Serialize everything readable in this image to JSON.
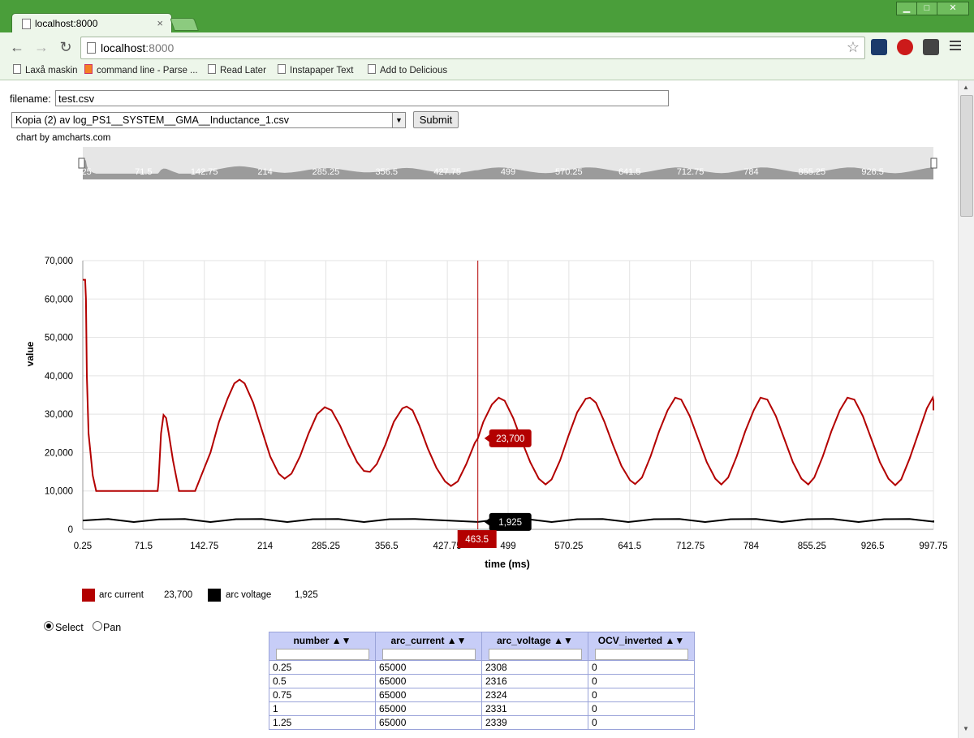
{
  "browser": {
    "tab_title": "localhost:8000",
    "url_host": "localhost",
    "url_port": ":8000",
    "bookmarks": [
      "Laxå maskin",
      "command line - Parse ...",
      "Read Later",
      "Instapaper Text",
      "Add to Delicious"
    ]
  },
  "form": {
    "filename_label": "filename:",
    "filename_value": "test.csv",
    "selected_file": "Kopia (2) av log_PS1__SYSTEM__GMA__Inductance_1.csv",
    "submit_label": "Submit"
  },
  "chart_credit": "chart by amcharts.com",
  "chart_data": {
    "type": "line",
    "xlabel": "time (ms)",
    "ylabel": "value",
    "ylim": [
      0,
      70000
    ],
    "yticks": [
      "0",
      "10,000",
      "20,000",
      "30,000",
      "40,000",
      "50,000",
      "60,000",
      "70,000"
    ],
    "xticks": [
      "0.25",
      "71.5",
      "142.75",
      "214",
      "285.25",
      "356.5",
      "427.75",
      "499",
      "570.25",
      "641.5",
      "712.75",
      "784",
      "855.25",
      "926.5",
      "997.75"
    ],
    "xlim": [
      0.25,
      997.75
    ],
    "grid": true,
    "cursor_x_label": "463.5",
    "series": [
      {
        "name": "arc current",
        "color": "#b30000",
        "cursor_value": "23,700",
        "points": [
          [
            0.25,
            65000
          ],
          [
            3,
            65000
          ],
          [
            4,
            60000
          ],
          [
            5,
            40000
          ],
          [
            7,
            25000
          ],
          [
            12,
            14000
          ],
          [
            16,
            10000
          ],
          [
            30,
            10000
          ],
          [
            60,
            10000
          ],
          [
            88,
            10000
          ],
          [
            89,
            12000
          ],
          [
            92,
            25000
          ],
          [
            95,
            29800
          ],
          [
            98,
            29000
          ],
          [
            101,
            25000
          ],
          [
            106,
            18000
          ],
          [
            113,
            10000
          ],
          [
            128,
            10000
          ],
          [
            132,
            10000
          ],
          [
            150,
            20000
          ],
          [
            160,
            28000
          ],
          [
            170,
            34000
          ],
          [
            178,
            38000
          ],
          [
            184,
            39000
          ],
          [
            190,
            38000
          ],
          [
            200,
            33000
          ],
          [
            210,
            26000
          ],
          [
            220,
            19000
          ],
          [
            230,
            14500
          ],
          [
            237,
            13200
          ],
          [
            245,
            14500
          ],
          [
            255,
            19000
          ],
          [
            265,
            25000
          ],
          [
            275,
            30000
          ],
          [
            284,
            31800
          ],
          [
            292,
            31000
          ],
          [
            302,
            27000
          ],
          [
            312,
            22000
          ],
          [
            322,
            17500
          ],
          [
            330,
            15200
          ],
          [
            337,
            15000
          ],
          [
            345,
            17000
          ],
          [
            355,
            22000
          ],
          [
            365,
            28000
          ],
          [
            375,
            31500
          ],
          [
            380,
            32000
          ],
          [
            387,
            31000
          ],
          [
            395,
            27000
          ],
          [
            405,
            21000
          ],
          [
            415,
            16000
          ],
          [
            425,
            12500
          ],
          [
            432,
            11300
          ],
          [
            440,
            12500
          ],
          [
            450,
            17000
          ],
          [
            460,
            22500
          ],
          [
            463.5,
            23700
          ],
          [
            470,
            28000
          ],
          [
            480,
            32500
          ],
          [
            488,
            34300
          ],
          [
            495,
            33500
          ],
          [
            505,
            29000
          ],
          [
            515,
            23000
          ],
          [
            525,
            17500
          ],
          [
            535,
            13200
          ],
          [
            543,
            11700
          ],
          [
            550,
            13000
          ],
          [
            560,
            18000
          ],
          [
            570,
            24500
          ],
          [
            580,
            30500
          ],
          [
            590,
            34000
          ],
          [
            595,
            34300
          ],
          [
            602,
            33000
          ],
          [
            612,
            28000
          ],
          [
            622,
            22000
          ],
          [
            632,
            16500
          ],
          [
            642,
            12800
          ],
          [
            648,
            11800
          ],
          [
            656,
            13500
          ],
          [
            666,
            19000
          ],
          [
            676,
            25500
          ],
          [
            686,
            31000
          ],
          [
            695,
            34300
          ],
          [
            702,
            33800
          ],
          [
            712,
            29500
          ],
          [
            722,
            23500
          ],
          [
            732,
            17500
          ],
          [
            742,
            13200
          ],
          [
            749,
            11700
          ],
          [
            757,
            13500
          ],
          [
            767,
            19000
          ],
          [
            777,
            25500
          ],
          [
            787,
            31000
          ],
          [
            795,
            34300
          ],
          [
            803,
            33800
          ],
          [
            813,
            29500
          ],
          [
            823,
            23500
          ],
          [
            833,
            17500
          ],
          [
            843,
            13200
          ],
          [
            851,
            11700
          ],
          [
            858,
            13500
          ],
          [
            868,
            19000
          ],
          [
            878,
            25500
          ],
          [
            888,
            31000
          ],
          [
            897,
            34300
          ],
          [
            905,
            33800
          ],
          [
            915,
            29500
          ],
          [
            925,
            23500
          ],
          [
            935,
            17500
          ],
          [
            945,
            13200
          ],
          [
            953,
            11500
          ],
          [
            960,
            13000
          ],
          [
            970,
            18500
          ],
          [
            980,
            25000
          ],
          [
            990,
            31500
          ],
          [
            997,
            34300
          ],
          [
            1007,
            33500
          ],
          [
            1015,
            31000
          ]
        ]
      },
      {
        "name": "arc voltage",
        "color": "#000000",
        "cursor_value": "1,925",
        "points": [
          [
            0.25,
            2308
          ],
          [
            30,
            2700
          ],
          [
            60,
            1900
          ],
          [
            90,
            2600
          ],
          [
            120,
            2700
          ],
          [
            150,
            1900
          ],
          [
            180,
            2650
          ],
          [
            210,
            2700
          ],
          [
            240,
            1900
          ],
          [
            270,
            2650
          ],
          [
            300,
            2700
          ],
          [
            330,
            1900
          ],
          [
            360,
            2650
          ],
          [
            390,
            2700
          ],
          [
            420,
            2400
          ],
          [
            463.5,
            1925
          ],
          [
            490,
            2650
          ],
          [
            520,
            2700
          ],
          [
            550,
            1900
          ],
          [
            580,
            2650
          ],
          [
            610,
            2700
          ],
          [
            640,
            1900
          ],
          [
            670,
            2650
          ],
          [
            700,
            2700
          ],
          [
            730,
            1900
          ],
          [
            760,
            2650
          ],
          [
            790,
            2700
          ],
          [
            820,
            1900
          ],
          [
            850,
            2650
          ],
          [
            880,
            2700
          ],
          [
            910,
            1900
          ],
          [
            940,
            2650
          ],
          [
            970,
            2700
          ],
          [
            1000,
            2000
          ],
          [
            1015,
            2300
          ]
        ]
      }
    ],
    "navigator_labels": [
      "0.25",
      "71.5",
      "142.75",
      "214",
      "285.25",
      "356.5",
      "427.75",
      "499",
      "570.25",
      "641.5",
      "712.75",
      "784",
      "855.25",
      "926.5"
    ]
  },
  "legend": [
    {
      "name": "arc current",
      "value": "23,700",
      "color": "#b30000"
    },
    {
      "name": "arc voltage",
      "value": "1,925",
      "color": "#000000"
    }
  ],
  "mode": {
    "select_label": "Select",
    "pan_label": "Pan",
    "selected": "select"
  },
  "table": {
    "columns": [
      "number ▲▼",
      "arc_current ▲▼",
      "arc_voltage ▲▼",
      "OCV_inverted ▲▼"
    ],
    "rows": [
      [
        "0.25",
        "65000",
        "2308",
        "0"
      ],
      [
        "0.5",
        "65000",
        "2316",
        "0"
      ],
      [
        "0.75",
        "65000",
        "2324",
        "0"
      ],
      [
        "1",
        "65000",
        "2331",
        "0"
      ],
      [
        "1.25",
        "65000",
        "2339",
        "0"
      ]
    ]
  }
}
